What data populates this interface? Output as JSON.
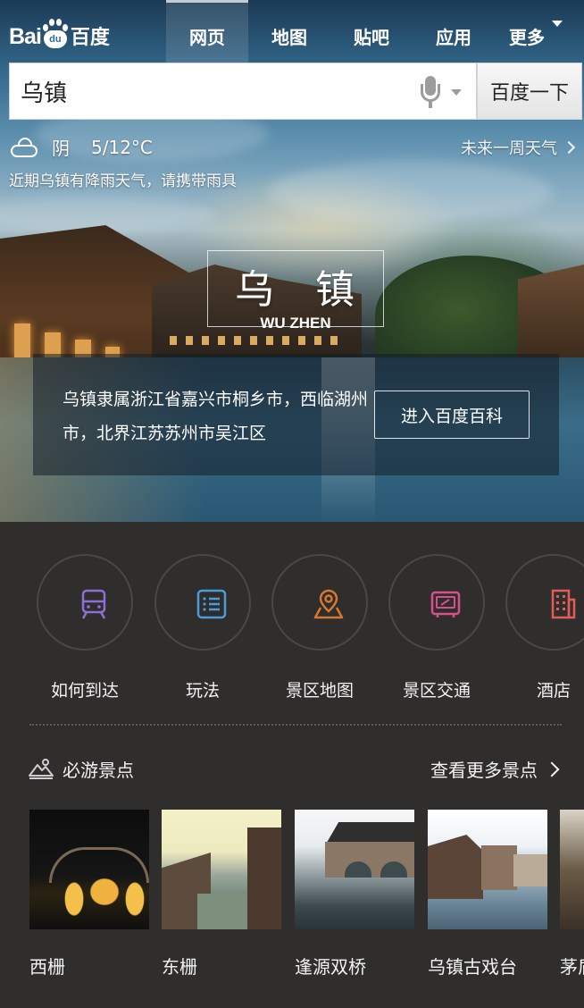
{
  "logo": {
    "bai": "Bai",
    "du": "du",
    "cn": "百度"
  },
  "nav": {
    "tabs": [
      {
        "label": "网页",
        "active": true
      },
      {
        "label": "地图",
        "active": false
      },
      {
        "label": "贴吧",
        "active": false
      },
      {
        "label": "应用",
        "active": false
      },
      {
        "label": "更多",
        "active": false
      }
    ]
  },
  "search": {
    "value": "乌镇",
    "button_label": "百度一下"
  },
  "weather": {
    "icon": "cloud-icon",
    "condition": "阴",
    "temperature": "5/12°C",
    "week_link": "未来一周天气",
    "tip": "近期乌镇有降雨天气，请携带雨具"
  },
  "place": {
    "title": "乌 镇",
    "subtitle_en": "WU ZHEN",
    "intro": "乌镇隶属浙江省嘉兴市桐乡市，西临湖州市，北界江苏苏州市吴江区",
    "baike_button": "进入百度百科"
  },
  "quick_links": [
    {
      "label": "如何到达",
      "icon": "train-icon",
      "color": "#8e6fd6"
    },
    {
      "label": "玩法",
      "icon": "list-icon",
      "color": "#4d9bd8"
    },
    {
      "label": "景区地图",
      "icon": "map-pin-icon",
      "color": "#d8782f"
    },
    {
      "label": "景区交通",
      "icon": "bus-icon",
      "color": "#d6508c"
    },
    {
      "label": "酒店",
      "icon": "hotel-icon",
      "color": "#e25c58"
    }
  ],
  "spots": {
    "title": "必游景点",
    "more_link": "查看更多景点",
    "items": [
      {
        "name": "西栅"
      },
      {
        "name": "东栅"
      },
      {
        "name": "逢源双桥"
      },
      {
        "name": "乌镇古戏台"
      },
      {
        "name": "茅盾故居"
      }
    ]
  }
}
